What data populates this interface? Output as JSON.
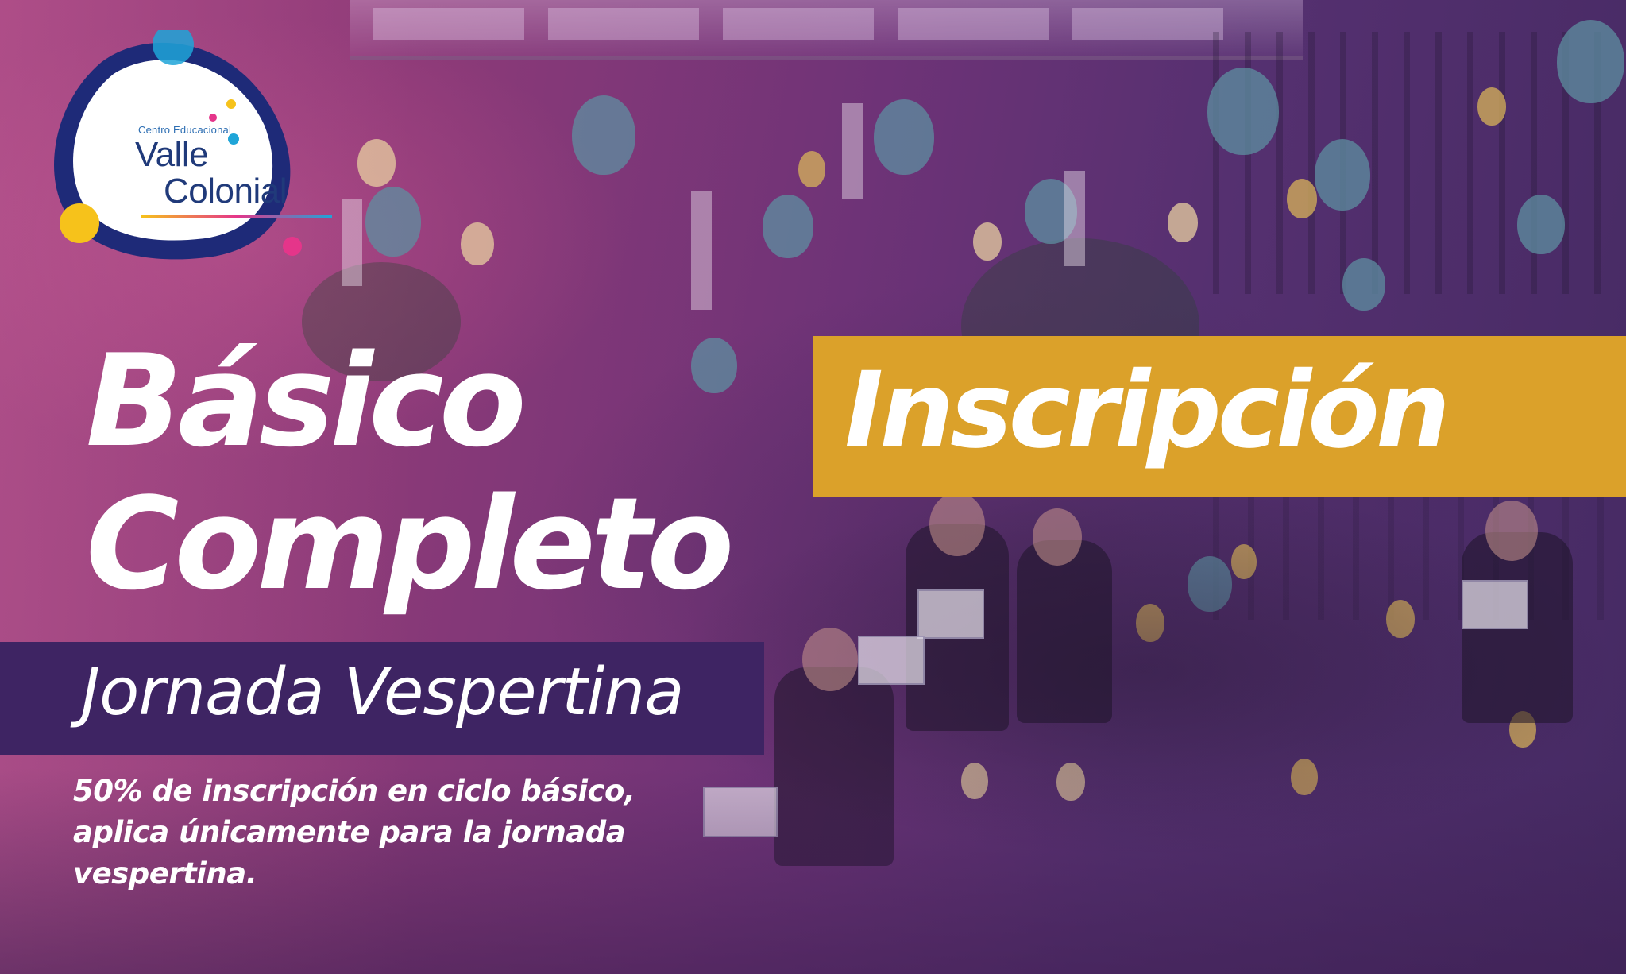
{
  "logo": {
    "subtitle": "Centro Educacional",
    "name_line1": "Valle",
    "name_line2": "Colonial",
    "colors": {
      "shape_navy": "#1e2a78",
      "shape_white": "#ffffff",
      "dot_yellow": "#f6c21b",
      "dot_cyan": "#1fa5d8",
      "dot_magenta": "#e5358a",
      "text_blue": "#203a7a"
    }
  },
  "headline": {
    "line1": "Básico",
    "line2": "Completo"
  },
  "banner": {
    "label": "Inscripción",
    "color": "#dba12a"
  },
  "schedule": {
    "label": "Jornada Vespertina",
    "color": "#3e2463"
  },
  "promo": {
    "lines": [
      "50%  de inscripción en ciclo básico,",
      "aplica únicamente para la jornada",
      "vespertina."
    ]
  },
  "palette": {
    "overlay_magenta": "#a23f7c",
    "overlay_purple": "#452a63",
    "text": "#ffffff"
  }
}
